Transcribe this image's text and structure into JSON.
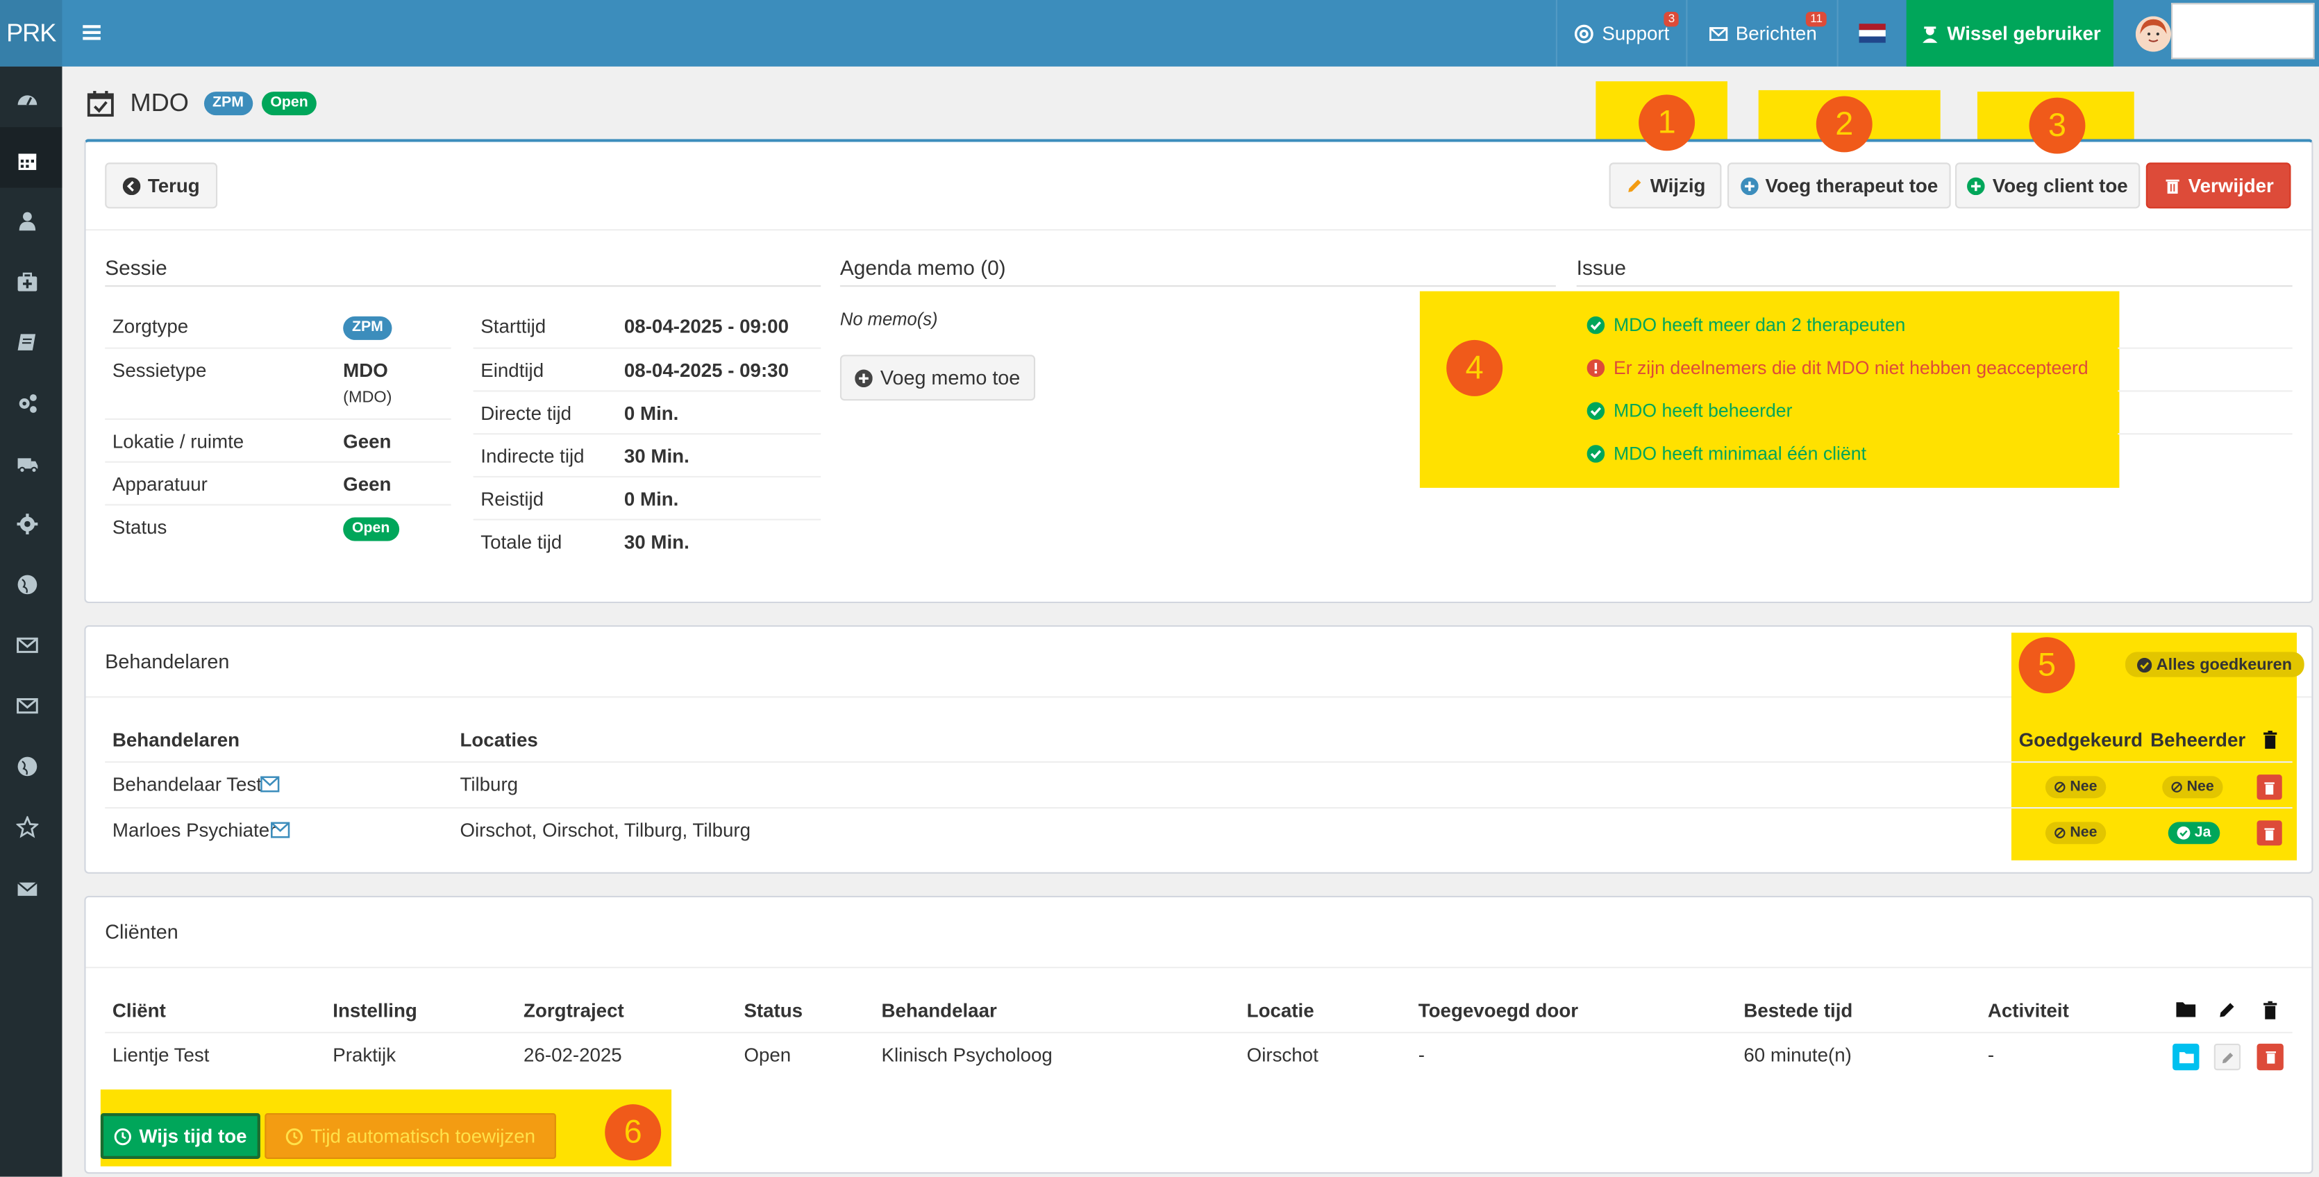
{
  "topbar": {
    "brand": "PRK",
    "support": {
      "label": "Support",
      "badge": "3"
    },
    "messages": {
      "label": "Berichten",
      "badge": "11"
    },
    "switch_user": "Wissel gebruiker"
  },
  "page": {
    "title": "MDO",
    "labels": [
      "ZPM",
      "Open"
    ]
  },
  "toolbar": {
    "back": "Terug",
    "edit": "Wijzig",
    "add_therapist": "Voeg therapeut toe",
    "add_client": "Voeg client toe",
    "delete": "Verwijder"
  },
  "annotations": [
    "1",
    "2",
    "3",
    "4",
    "5",
    "6"
  ],
  "session": {
    "heading": "Sessie",
    "left": [
      {
        "label": "Zorgtype",
        "value": "ZPM",
        "badge": true
      },
      {
        "label": "Sessietype",
        "value": "MDO",
        "sub": "(MDO)"
      },
      {
        "label": "Lokatie / ruimte",
        "value": "Geen"
      },
      {
        "label": "Apparatuur",
        "value": "Geen"
      },
      {
        "label": "Status",
        "value": "Open",
        "badge": true
      }
    ],
    "right": [
      {
        "label": "Starttijd",
        "value": "08-04-2025 - 09:00"
      },
      {
        "label": "Eindtijd",
        "value": "08-04-2025 - 09:30"
      },
      {
        "label": "Directe tijd",
        "value": "0 Min."
      },
      {
        "label": "Indirecte tijd",
        "value": "30 Min."
      },
      {
        "label": "Reistijd",
        "value": "0 Min."
      },
      {
        "label": "Totale tijd",
        "value": "30 Min."
      }
    ]
  },
  "memo": {
    "heading": "Agenda memo (0)",
    "empty": "No memo(s)",
    "add": "Voeg memo toe"
  },
  "issue": {
    "heading": "Issue",
    "items": [
      {
        "text": "MDO heeft meer dan 2 therapeuten",
        "ok": true
      },
      {
        "text": "Er zijn deelnemers die dit MDO niet hebben geaccepteerd",
        "ok": false
      },
      {
        "text": "MDO heeft beheerder",
        "ok": true
      },
      {
        "text": "MDO heeft minimaal één cliënt",
        "ok": true
      }
    ]
  },
  "therapists": {
    "heading": "Behandelaren",
    "approve_all": "Alles goedkeuren",
    "columns": [
      "Behandelaren",
      "Locaties",
      "Goedgekeurd",
      "Beheerder"
    ],
    "rows": [
      {
        "name": "Behandelaar Test",
        "locations": "Tilburg",
        "approved": "Nee",
        "manager": "Nee"
      },
      {
        "name": "Marloes Psychiater",
        "locations": "Oirschot, Oirschot, Tilburg, Tilburg",
        "approved": "Nee",
        "manager": "Ja"
      }
    ]
  },
  "clients": {
    "heading": "Cliënten",
    "columns": [
      "Cliënt",
      "Instelling",
      "Zorgtraject",
      "Status",
      "Behandelaar",
      "Locatie",
      "Toegevoegd door",
      "Bestede tijd",
      "Activiteit"
    ],
    "rows": [
      {
        "client": "Lientje Test",
        "institution": "Praktijk",
        "trajectory": "26-02-2025",
        "status": "Open",
        "therapist": "Klinisch Psycholoog",
        "location": "Oirschot",
        "added_by": "-",
        "time": "60 minute(n)",
        "activity": "-"
      }
    ],
    "assign_time": "Wijs tijd toe",
    "auto_assign": "Tijd automatisch toewijzen"
  },
  "colors": {
    "topbar": "#3c8dbc",
    "sidebar": "#222d32",
    "green": "#00a65a",
    "red": "#dd4b39",
    "highlight": "#ffe100",
    "marker": "#f05a1a"
  }
}
